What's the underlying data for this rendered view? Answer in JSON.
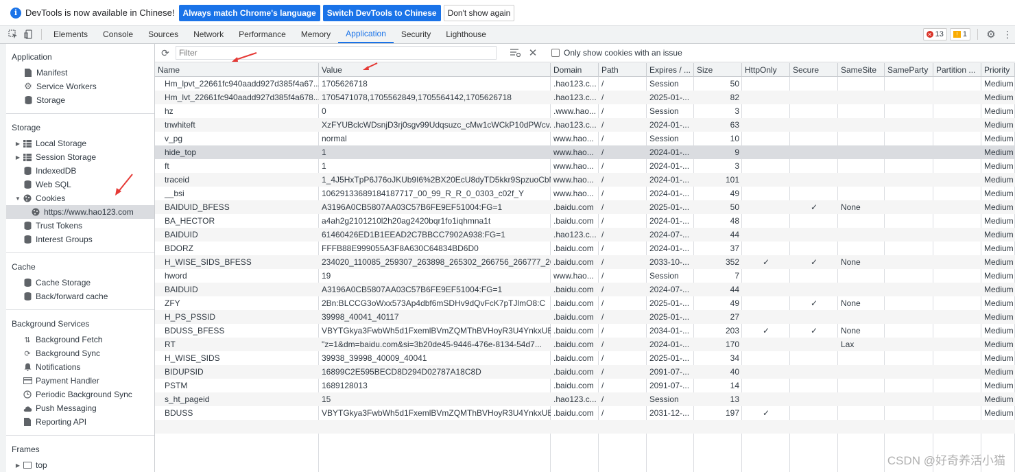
{
  "infobar": {
    "message": "DevTools is now available in Chinese!",
    "btn_match": "Always match Chrome's language",
    "btn_switch": "Switch DevTools to Chinese",
    "btn_dont_show": "Don't show again"
  },
  "tabs": [
    "Elements",
    "Console",
    "Sources",
    "Network",
    "Performance",
    "Memory",
    "Application",
    "Security",
    "Lighthouse"
  ],
  "active_tab": "Application",
  "counts": {
    "errors": "13",
    "warnings": "1"
  },
  "sidebar": {
    "application": {
      "title": "Application",
      "items": [
        "Manifest",
        "Service Workers",
        "Storage"
      ]
    },
    "storage": {
      "title": "Storage",
      "items": [
        "Local Storage",
        "Session Storage",
        "IndexedDB",
        "Web SQL",
        "Cookies",
        "https://www.hao123.com",
        "Trust Tokens",
        "Interest Groups"
      ]
    },
    "cache": {
      "title": "Cache",
      "items": [
        "Cache Storage",
        "Back/forward cache"
      ]
    },
    "background": {
      "title": "Background Services",
      "items": [
        "Background Fetch",
        "Background Sync",
        "Notifications",
        "Payment Handler",
        "Periodic Background Sync",
        "Push Messaging",
        "Reporting API"
      ]
    },
    "frames": {
      "title": "Frames",
      "items": [
        "top"
      ]
    }
  },
  "toolbar": {
    "filter_placeholder": "Filter",
    "only_issues_label": "Only show cookies with an issue"
  },
  "table": {
    "headers": [
      "Name",
      "Value",
      "Domain",
      "Path",
      "Expires / ...",
      "Size",
      "HttpOnly",
      "Secure",
      "SameSite",
      "SameParty",
      "Partition ...",
      "Priority"
    ],
    "rows": [
      [
        "Hm_lpvt_22661fc940aadd927d385f4a67...",
        "1705626718",
        ".hao123.c...",
        "/",
        "Session",
        "50",
        "",
        "",
        "",
        "",
        "",
        "Medium"
      ],
      [
        "Hm_lvt_22661fc940aadd927d385f4a678...",
        "1705471078,1705562849,1705564142,1705626718",
        ".hao123.c...",
        "/",
        "2025-01-...",
        "82",
        "",
        "",
        "",
        "",
        "",
        "Medium"
      ],
      [
        "hz",
        "0",
        ".www.hao...",
        "/",
        "Session",
        "3",
        "",
        "",
        "",
        "",
        "",
        "Medium"
      ],
      [
        "tnwhiteft",
        "XzFYUBclcWDsnjD3rj0sgv99Udqsuzc_cMw1cWCkP10dPWcv...",
        ".hao123.c...",
        "/",
        "2024-01-...",
        "63",
        "",
        "",
        "",
        "",
        "",
        "Medium"
      ],
      [
        "v_pg",
        "normal",
        "www.hao...",
        "/",
        "Session",
        "10",
        "",
        "",
        "",
        "",
        "",
        "Medium"
      ],
      [
        "hide_top",
        "1",
        "www.hao...",
        "/",
        "2024-01-...",
        "9",
        "",
        "",
        "",
        "",
        "",
        "Medium"
      ],
      [
        "ft",
        "1",
        "www.hao...",
        "/",
        "2024-01-...",
        "3",
        "",
        "",
        "",
        "",
        "",
        "Medium"
      ],
      [
        "traceid",
        "1_4J5HxTpP6J76oJKUb9I6%2BX20EcU8dyTD5kkr9SpzuoCbN...",
        "www.hao...",
        "/",
        "2024-01-...",
        "101",
        "",
        "",
        "",
        "",
        "",
        "Medium"
      ],
      [
        "__bsi",
        "10629133689184187717_00_99_R_R_0_0303_c02f_Y",
        "www.hao...",
        "/",
        "2024-01-...",
        "49",
        "",
        "",
        "",
        "",
        "",
        "Medium"
      ],
      [
        "BAIDUID_BFESS",
        "A3196A0CB5807AA03C57B6FE9EF51004:FG=1",
        ".baidu.com",
        "/",
        "2025-01-...",
        "50",
        "",
        "✓",
        "None",
        "",
        "",
        "Medium"
      ],
      [
        "BA_HECTOR",
        "a4ah2g2101210l2h20ag2420bqr1fo1iqhmna1t",
        ".baidu.com",
        "/",
        "2024-01-...",
        "48",
        "",
        "",
        "",
        "",
        "",
        "Medium"
      ],
      [
        "BAIDUID",
        "61460426ED1B1EEAD2C7BBCC7902A938:FG=1",
        ".hao123.c...",
        "/",
        "2024-07-...",
        "44",
        "",
        "",
        "",
        "",
        "",
        "Medium"
      ],
      [
        "BDORZ",
        "FFFB88E999055A3F8A630C64834BD6D0",
        ".baidu.com",
        "/",
        "2024-01-...",
        "37",
        "",
        "",
        "",
        "",
        "",
        "Medium"
      ],
      [
        "H_WISE_SIDS_BFESS",
        "234020_110085_259307_263898_265302_266756_266777_26...",
        ".baidu.com",
        "/",
        "2033-10-...",
        "352",
        "✓",
        "✓",
        "None",
        "",
        "",
        "Medium"
      ],
      [
        "hword",
        "19",
        "www.hao...",
        "/",
        "Session",
        "7",
        "",
        "",
        "",
        "",
        "",
        "Medium"
      ],
      [
        "BAIDUID",
        "A3196A0CB5807AA03C57B6FE9EF51004:FG=1",
        ".baidu.com",
        "/",
        "2024-07-...",
        "44",
        "",
        "",
        "",
        "",
        "",
        "Medium"
      ],
      [
        "ZFY",
        "2Bn:BLCCG3oWxx573Ap4dbf6mSDHv9dQvFcK7pTJlmO8:C",
        ".baidu.com",
        "/",
        "2025-01-...",
        "49",
        "",
        "✓",
        "None",
        "",
        "",
        "Medium"
      ],
      [
        "H_PS_PSSID",
        "39998_40041_40117",
        ".baidu.com",
        "/",
        "2025-01-...",
        "27",
        "",
        "",
        "",
        "",
        "",
        "Medium"
      ],
      [
        "BDUSS_BFESS",
        "VBYTGkya3FwbWh5d1FxemlBVmZQMThBVHoyR3U4YnkxUE...",
        ".baidu.com",
        "/",
        "2034-01-...",
        "203",
        "✓",
        "✓",
        "None",
        "",
        "",
        "Medium"
      ],
      [
        "RT",
        "\"z=1&dm=baidu.com&si=3b20de45-9446-476e-8134-54d7...",
        ".baidu.com",
        "/",
        "2024-01-...",
        "170",
        "",
        "",
        "Lax",
        "",
        "",
        "Medium"
      ],
      [
        "H_WISE_SIDS",
        "39938_39998_40009_40041",
        ".baidu.com",
        "/",
        "2025-01-...",
        "34",
        "",
        "",
        "",
        "",
        "",
        "Medium"
      ],
      [
        "BIDUPSID",
        "16899C2E595BECD8D294D02787A18C8D",
        ".baidu.com",
        "/",
        "2091-07-...",
        "40",
        "",
        "",
        "",
        "",
        "",
        "Medium"
      ],
      [
        "PSTM",
        "1689128013",
        ".baidu.com",
        "/",
        "2091-07-...",
        "14",
        "",
        "",
        "",
        "",
        "",
        "Medium"
      ],
      [
        "s_ht_pageid",
        "15",
        ".hao123.c...",
        "/",
        "Session",
        "13",
        "",
        "",
        "",
        "",
        "",
        "Medium"
      ],
      [
        "BDUSS",
        "VBYTGkya3FwbWh5d1FxemlBVmZQMThBVHoyR3U4YnkxUE...",
        ".baidu.com",
        "/",
        "2031-12-...",
        "197",
        "✓",
        "",
        "",
        "",
        "",
        "Medium"
      ]
    ],
    "selected_row": 5
  },
  "watermark": "CSDN @好奇养活小猫",
  "colors": {
    "accent": "#1a73e8",
    "annotation": "#e53935"
  }
}
